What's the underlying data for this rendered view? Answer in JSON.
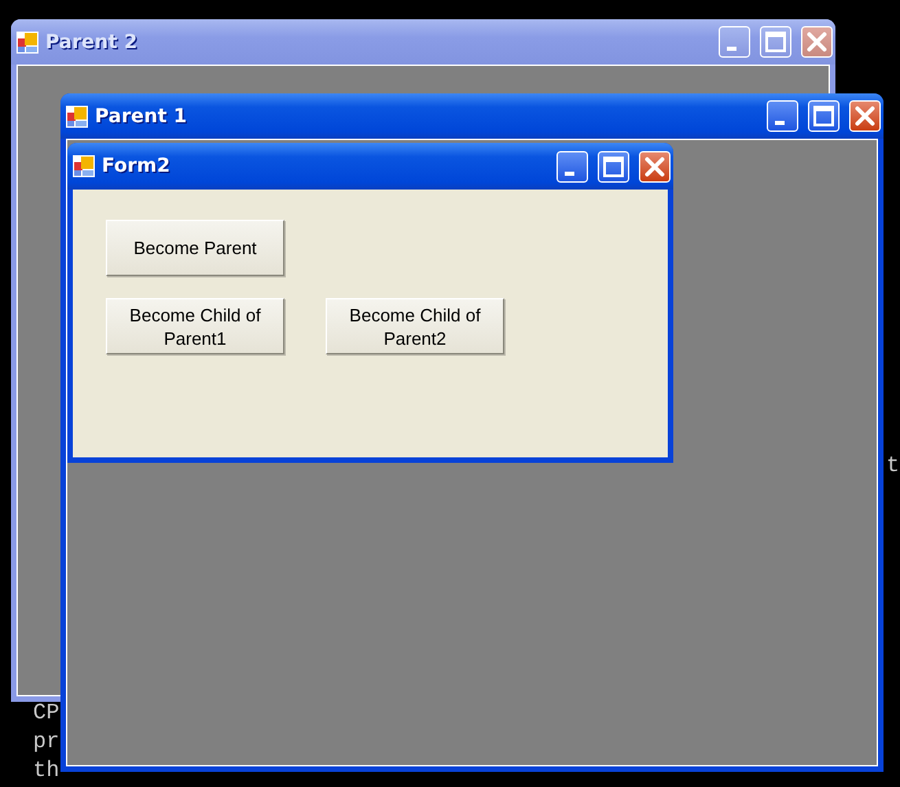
{
  "console_lines": [
    {
      "text": "CP"
    },
    {
      "text": "pr"
    },
    {
      "text": "th"
    }
  ],
  "console_edge_text": "t",
  "windows": [
    {
      "title": "Parent 2",
      "active": false
    },
    {
      "title": "Parent 1",
      "active": true,
      "children": [
        {
          "title": "Form2",
          "active": true,
          "buttons": [
            [
              "Become Parent"
            ],
            [
              "Become Child of Parent1",
              "Become Child of Parent2"
            ]
          ]
        }
      ]
    }
  ]
}
